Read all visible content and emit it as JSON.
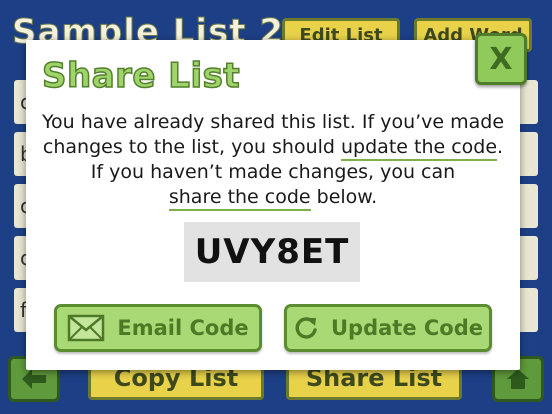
{
  "background": {
    "title": "Sample List 2",
    "top_buttons": {
      "edit_list": "Edit List",
      "add_word": "Add Word"
    },
    "list_rows": [
      "c",
      "b",
      "c",
      "c",
      "f"
    ],
    "bottom_buttons": {
      "copy_list": "Copy List",
      "share_list": "Share List"
    },
    "icons": {
      "back": "back-arrow-icon",
      "home": "home-icon"
    }
  },
  "modal": {
    "title": "Share List",
    "close_label": "X",
    "message": {
      "l1": "You have already shared this list. If you’ve made",
      "l2_pre": "changes to the list, you should ",
      "l2_link": "update the code",
      "l2_post": ".",
      "l3": "If you haven’t made changes, you can",
      "l4_link": "share the code",
      "l4_post": " below."
    },
    "code": "UVY8ET",
    "buttons": {
      "email": {
        "label": "Email Code",
        "icon": "envelope-icon"
      },
      "update": {
        "label": "Update Code",
        "icon": "refresh-icon"
      }
    }
  },
  "colors": {
    "accent_green": "#a8d975",
    "title_green": "#9ed46a",
    "background_blue": "#1d3f86",
    "yellow_button": "#e8d24a"
  }
}
